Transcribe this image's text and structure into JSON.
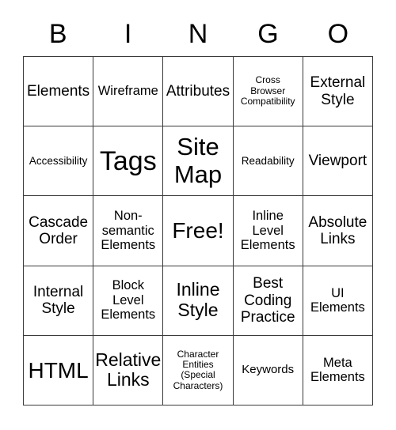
{
  "card": {
    "header_letters": [
      "B",
      "I",
      "N",
      "G",
      "O"
    ],
    "columns": 5,
    "rows": 5,
    "border_color": "#3a3a3a",
    "background_color": "#ffffff",
    "text_color": "#000000",
    "cells": [
      {
        "text": "Elements",
        "size": "xl"
      },
      {
        "text": "Wireframe",
        "size": "lg"
      },
      {
        "text": "Attributes",
        "size": "xl"
      },
      {
        "text": "Cross\nBrowser\nCompatibility",
        "size": "xs"
      },
      {
        "text": "External\nStyle",
        "size": "xl"
      },
      {
        "text": "Accessibility",
        "size": "sm"
      },
      {
        "text": "Tags",
        "size": "5xl"
      },
      {
        "text": "Site\nMap",
        "size": "4xl"
      },
      {
        "text": "Readability",
        "size": "sm"
      },
      {
        "text": "Viewport",
        "size": "xl"
      },
      {
        "text": "Cascade\nOrder",
        "size": "xl"
      },
      {
        "text": "Non-\nsemantic\nElements",
        "size": "lg"
      },
      {
        "text": "Free!",
        "size": "3xl"
      },
      {
        "text": "Inline\nLevel\nElements",
        "size": "lg"
      },
      {
        "text": "Absolute\nLinks",
        "size": "xl"
      },
      {
        "text": "Internal\nStyle",
        "size": "xl"
      },
      {
        "text": "Block\nLevel\nElements",
        "size": "lg"
      },
      {
        "text": "Inline\nStyle",
        "size": "2xl"
      },
      {
        "text": "Best\nCoding\nPractice",
        "size": "xl"
      },
      {
        "text": "UI\nElements",
        "size": "lg"
      },
      {
        "text": "HTML",
        "size": "3xl"
      },
      {
        "text": "Relative\nLinks",
        "size": "2xl"
      },
      {
        "text": "Character\nEntities\n(Special\nCharacters)",
        "size": "xs"
      },
      {
        "text": "Keywords",
        "size": "md"
      },
      {
        "text": "Meta\nElements",
        "size": "lg"
      }
    ]
  }
}
